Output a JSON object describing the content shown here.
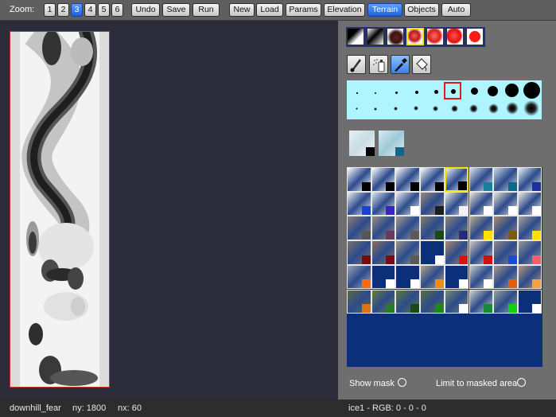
{
  "toolbar": {
    "zoom_label": "Zoom:",
    "zoom_levels": [
      "1",
      "2",
      "3",
      "4",
      "5",
      "6"
    ],
    "zoom_selected": "3",
    "buttons": {
      "undo": "Undo",
      "save": "Save",
      "run": "Run",
      "new": "New",
      "load": "Load",
      "params": "Params",
      "elevation": "Elevation",
      "terrain": "Terrain",
      "objects": "Objects",
      "auto": "Auto"
    },
    "active_mode": "Terrain",
    "accent_color": "#2f6df0"
  },
  "map": {
    "border_color": "#c83030"
  },
  "brush": {
    "selected_shape_index": 3,
    "tools": [
      "brush-icon",
      "spray-icon",
      "eyedropper-icon",
      "bucket-icon"
    ],
    "active_tool": "eyedropper-icon",
    "selected_size_index": 5
  },
  "textures": {
    "recent_count": 2,
    "selected_cell": "row 1, col 5"
  },
  "options": {
    "show_mask_label": "Show mask",
    "limit_label": "Limit to masked area",
    "show_mask": false,
    "limit_to_mask": false
  },
  "status": {
    "level_name": "downhill_fear",
    "ny_label": "ny: 1800",
    "nx_label": "nx: 60",
    "texture_info": "ice1 - RGB: 0 - 0 - 0"
  }
}
